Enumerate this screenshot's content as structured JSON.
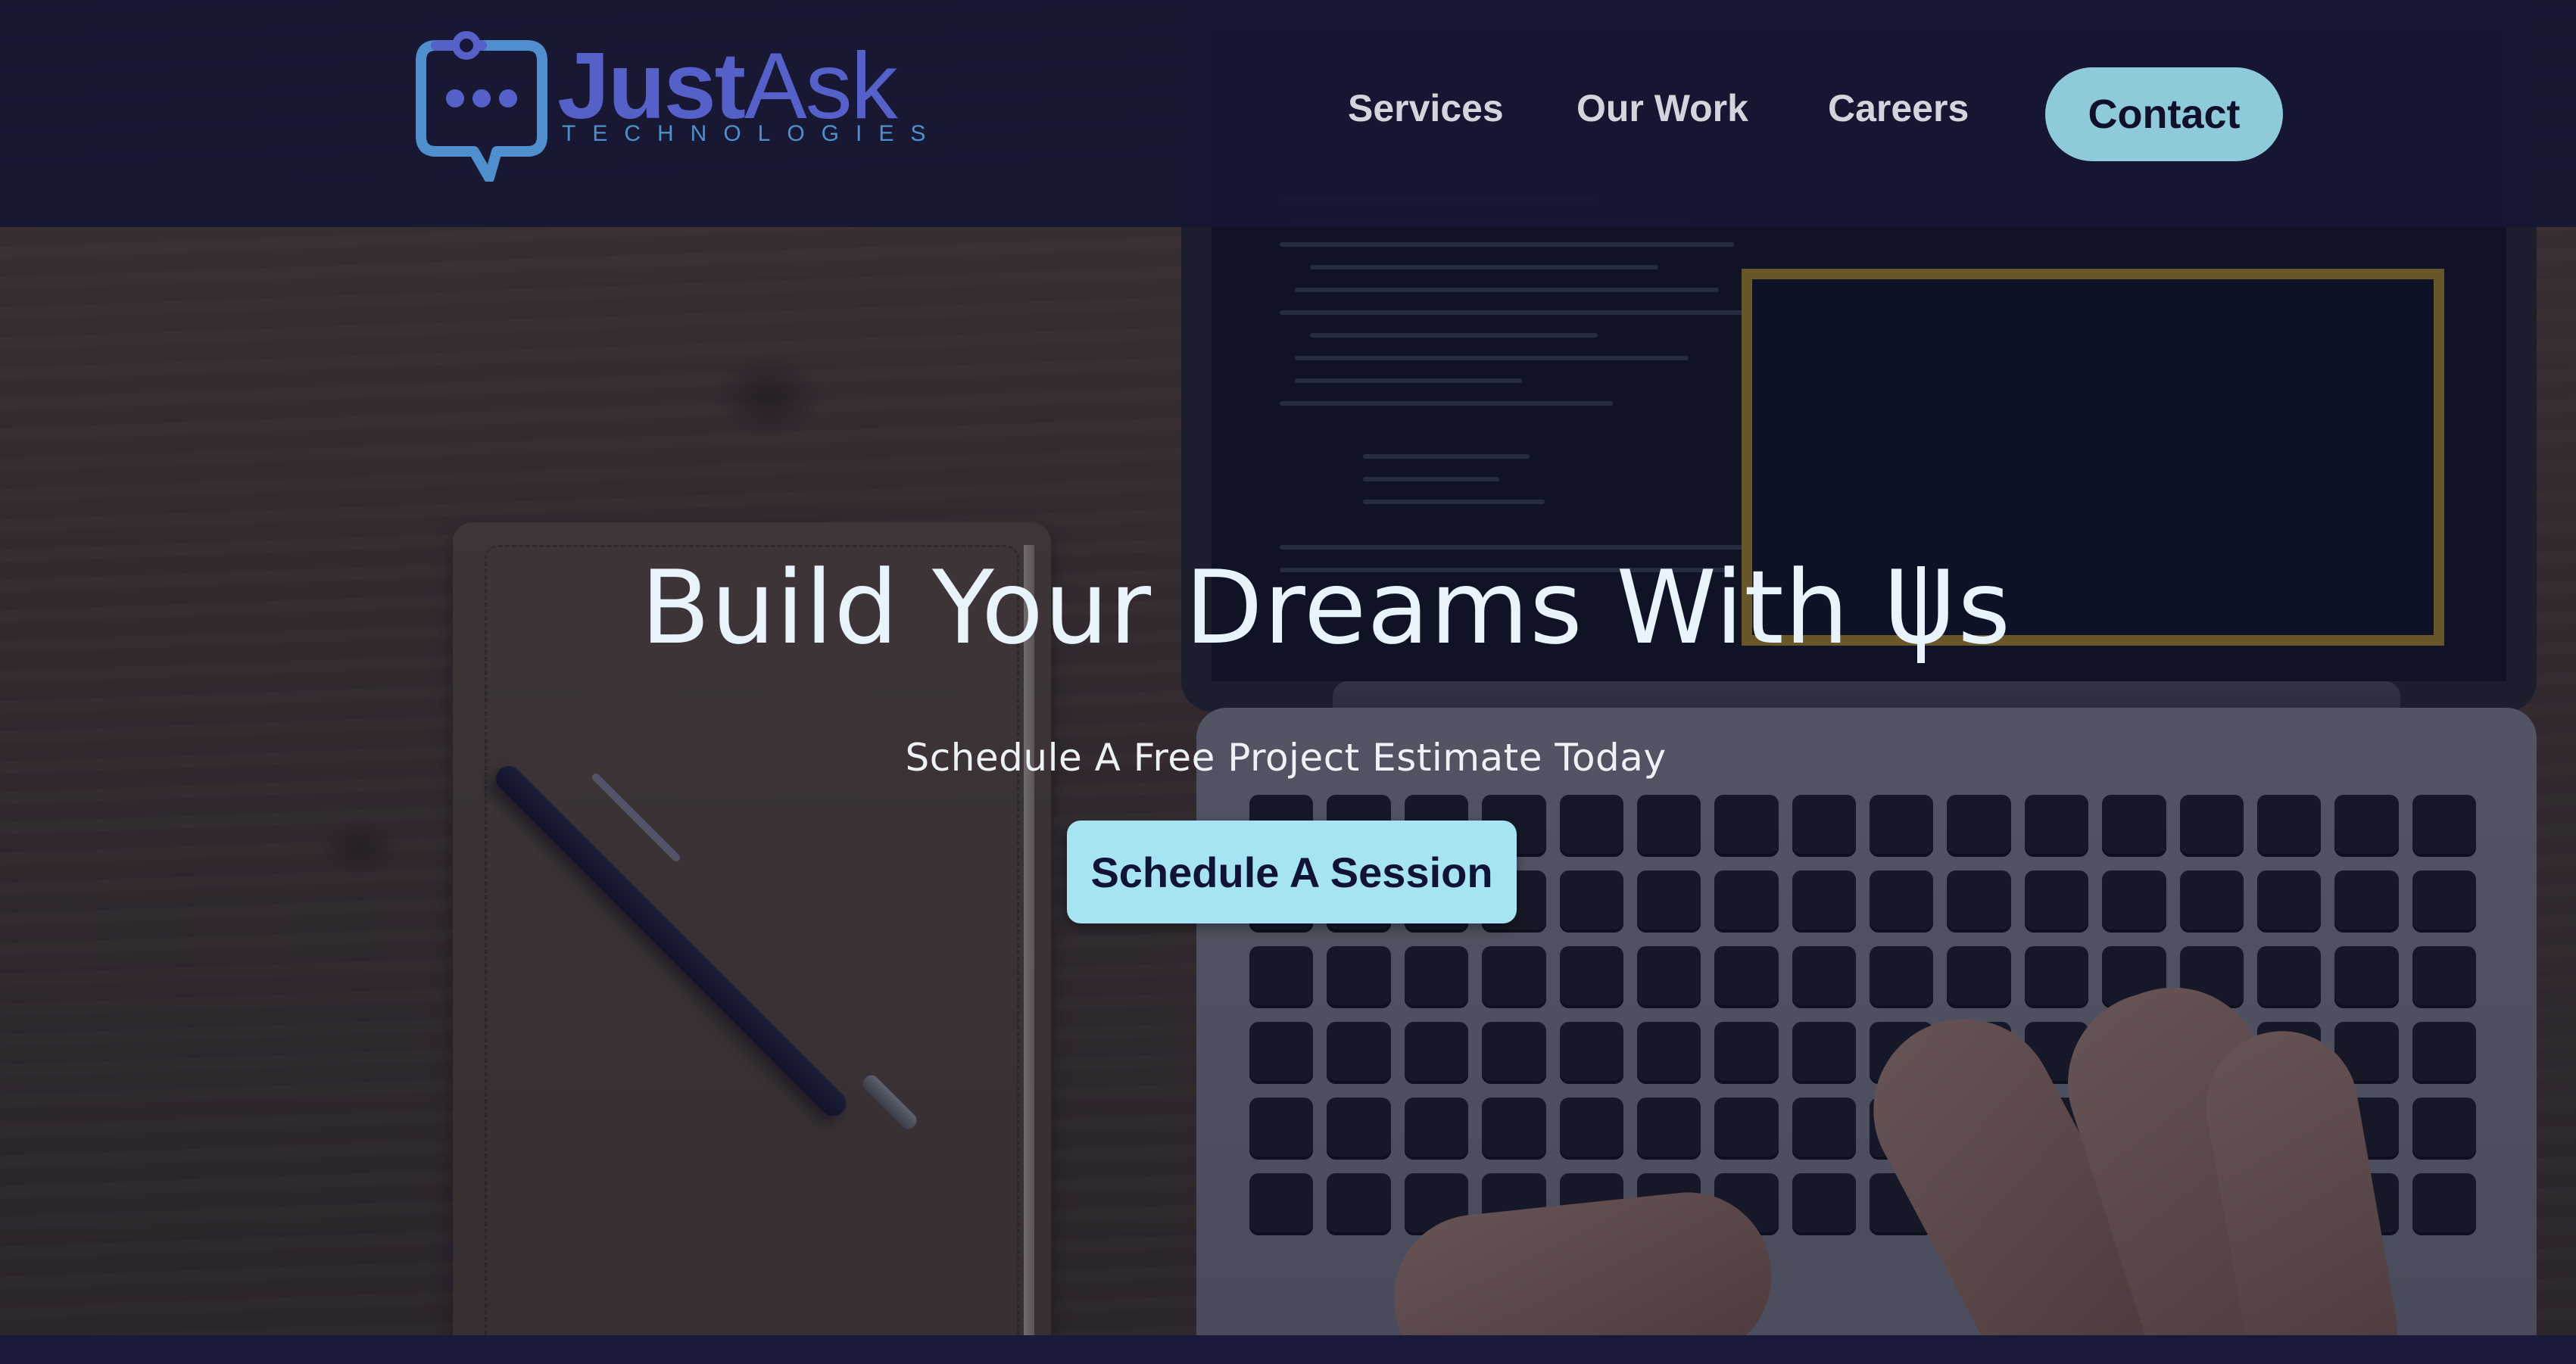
{
  "brand": {
    "name_part1": "Just",
    "name_part2": "Ask",
    "tagline": "TECHNOLOGIES",
    "colors": {
      "primary": "#5560c8",
      "secondary": "#4f8fce"
    },
    "icon": "chat-bubble-icon"
  },
  "nav": {
    "items": [
      {
        "label": "Services"
      },
      {
        "label": "Our Work"
      },
      {
        "label": "Careers"
      }
    ],
    "contact_label": "Contact"
  },
  "hero": {
    "title": "Build Your Dreams With Us",
    "subtitle": "Schedule A Free Project Estimate Today",
    "cta_label": "Schedule A Session",
    "background_description_icon": "laptop-desk-photo"
  },
  "colors": {
    "header_bg": "#16173a",
    "contact_button": "#8fcadb",
    "cta_button": "#a6e3f3",
    "title_text": "#e8f3fb"
  }
}
